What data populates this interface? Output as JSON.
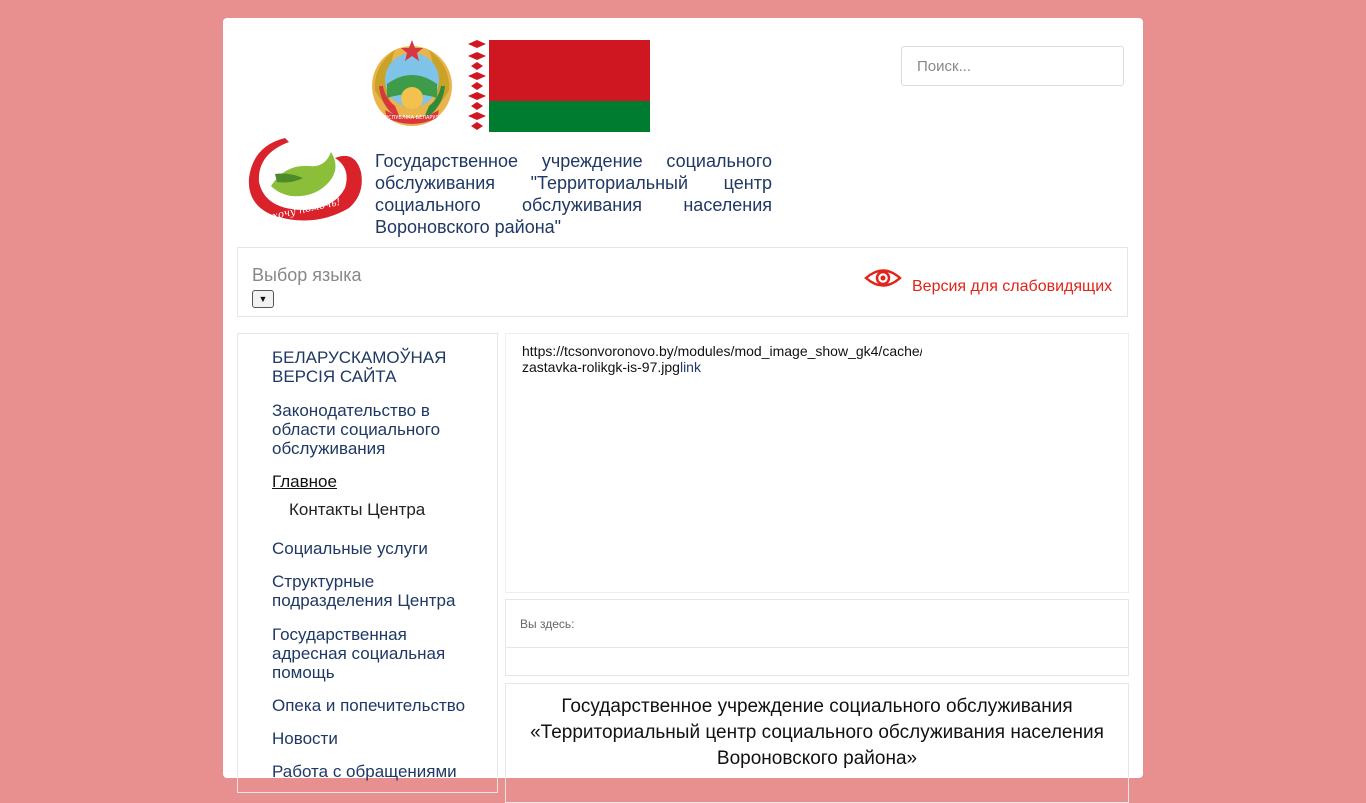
{
  "header": {
    "search_placeholder": "Поиск...",
    "org_title_line1": "Государственное учреждение социального",
    "org_title_line2": "обслуживания \"Территориальный центр",
    "org_title_line3": "социального обслуживания населения",
    "org_title_line4": "Вороновского района\"",
    "emblem_text": "РЭСПУБЛІКА БЕЛАРУСЬ",
    "logo_text": "хочу помочь!"
  },
  "langbar": {
    "label": "Выбор языка",
    "low_vision_label": "Версия для слабовидящих"
  },
  "sidebar": {
    "items": [
      {
        "label": "БЕЛАРУСКАМОЎНАЯ ВЕРСІЯ САЙТА"
      },
      {
        "label": "Законодательство в области социального обслуживания"
      },
      {
        "label": "Главное"
      },
      {
        "label": "Контакты Центра"
      },
      {
        "label": "Социальные услуги"
      },
      {
        "label": "Структурные подразделения Центра"
      },
      {
        "label": "Государственная адресная социальная помощь"
      },
      {
        "label": "Опека и попечительство"
      },
      {
        "label": "Новости"
      },
      {
        "label": "Работа с обращениями"
      }
    ]
  },
  "slider": {
    "url_line1": "https://tcsonvoronovo.by/modules/mod_image_show_gk4/cache/",
    "url_line2": "zastavka-rolikgk-is-97.jpg",
    "link_label": "link"
  },
  "breadcrumb": {
    "label": "Вы здесь:"
  },
  "article": {
    "title_line1": "Государственное учреждение социального обслуживания",
    "title_line2": "«Территориальный центр социального обслуживания населения",
    "title_line3": "Вороновского района»"
  },
  "colors": {
    "background": "#e8908f",
    "link": "#1f3864",
    "accent_red": "#e2231a",
    "flag_red": "#ce1720",
    "flag_green": "#007c30"
  }
}
